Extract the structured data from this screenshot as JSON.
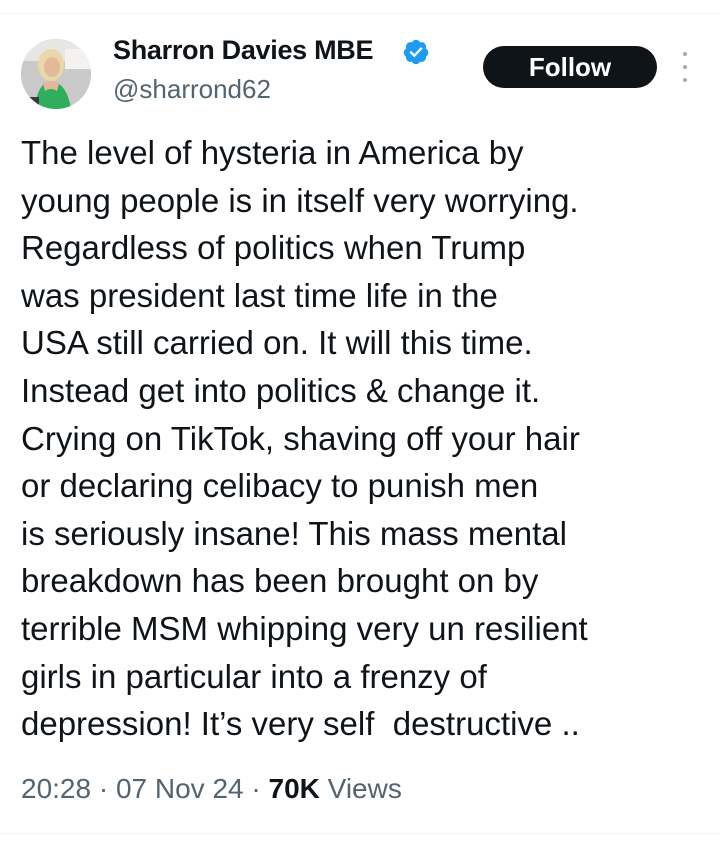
{
  "author": {
    "display_name": "Sharron Davies MBE",
    "handle": "@sharrond62",
    "verified": true
  },
  "follow_button": {
    "label": "Follow"
  },
  "tweet": {
    "lines": [
      "The level of hysteria in America by",
      "young people is in itself very worrying.",
      "Regardless of politics when Trump",
      "was president last time life in the",
      "USA still carried on. It will this time.",
      "Instead get into politics & change it.",
      "Crying on TikTok, shaving off your hair",
      "or declaring celibacy to punish men",
      "is seriously insane! This mass mental",
      "breakdown has been brought on by",
      "terrible MSM whipping very un resilient",
      "girls in particular into a frenzy of",
      "depression! It’s very self  destructive .."
    ]
  },
  "meta": {
    "time": "20:28",
    "separator": " · ",
    "date": "07 Nov 24",
    "views_count": "70K",
    "views_label": " Views"
  },
  "colors": {
    "text": "#0f1419",
    "secondary_text": "#536471",
    "verified_blue": "#1d9bf0",
    "button_bg": "#0f1419",
    "divider": "#eff3f4"
  }
}
